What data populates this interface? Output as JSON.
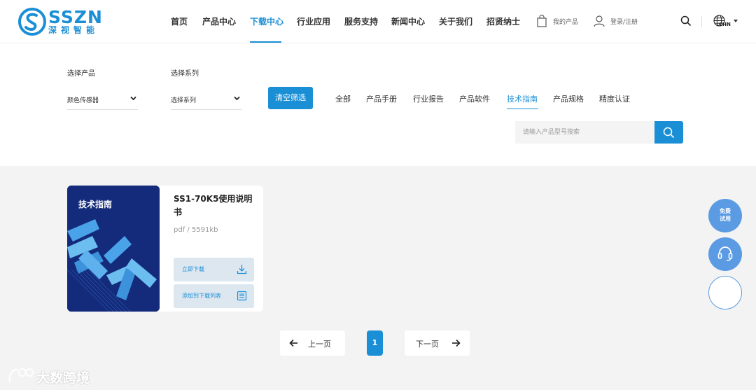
{
  "brand": {
    "name": "SSZN",
    "subtitle": "深视智能",
    "color": "#1b8fd6"
  },
  "nav": {
    "items": [
      "首页",
      "产品中心",
      "下载中心",
      "行业应用",
      "服务支持",
      "新闻中心",
      "关于我们",
      "招贤纳士"
    ],
    "active": "下载中心"
  },
  "header": {
    "my_products": "我的产品",
    "login": "登录/注册",
    "language": "CHN",
    "icons": [
      "shopping-bag-icon",
      "user-icon",
      "search-icon",
      "globe-icon"
    ]
  },
  "filters": {
    "product_label": "选择产品",
    "product_value": "颜色传感器",
    "series_label": "选择系列",
    "series_value": "选择系列",
    "clear_button": "清空筛选"
  },
  "categories": {
    "tabs": [
      "全部",
      "产品手册",
      "行业报告",
      "产品软件",
      "技术指南",
      "产品规格",
      "精度认证"
    ],
    "active": "技术指南"
  },
  "search": {
    "placeholder": "请输入产品型号搜索"
  },
  "document": {
    "thumb_label": "技术指南",
    "title": "SS1-70K5使用说明书",
    "meta": "pdf / 5591kb",
    "download_button": "立即下载",
    "add_list_button": "添加到下载列表"
  },
  "pagination": {
    "prev": "上一页",
    "current": "1",
    "next": "下一页"
  },
  "floating": {
    "trial": [
      "免费",
      "试用"
    ]
  },
  "watermark": {
    "text": "大数跨境"
  }
}
